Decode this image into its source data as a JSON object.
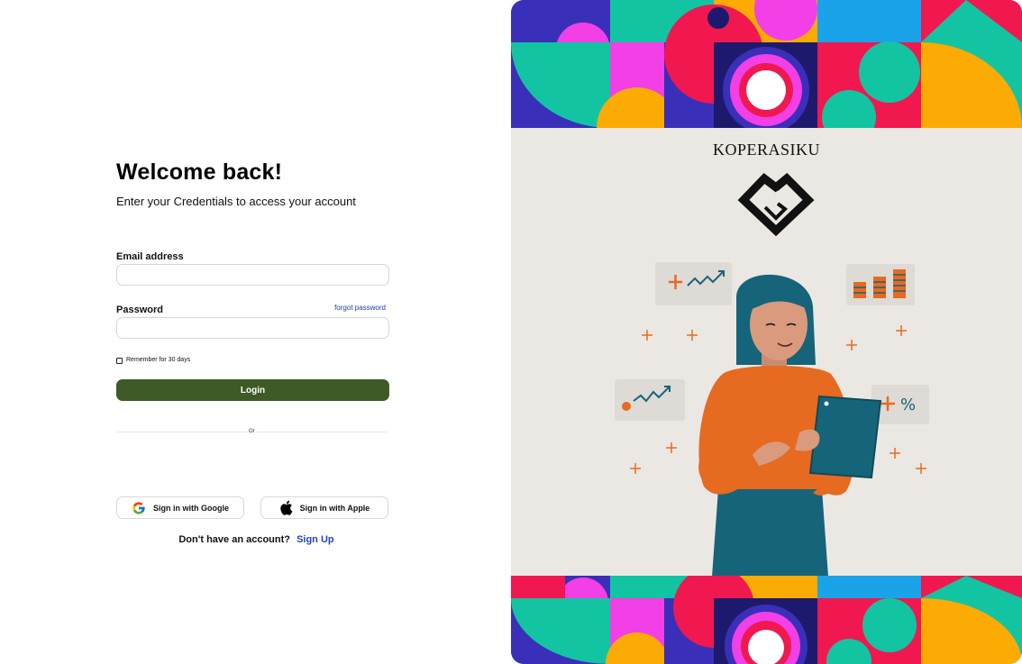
{
  "form": {
    "title": "Welcome back!",
    "subtitle": "Enter your Credentials to access your account",
    "email_label": "Email address",
    "email_value": "",
    "password_label": "Password",
    "password_value": "",
    "forgot_password": "forgot password",
    "remember_label": "Remember for 30 days",
    "login_button": "Login",
    "divider_text": "Or",
    "google_button": "Sign in with Google",
    "apple_button": "Sign in with Apple",
    "signup_prompt": "Don't have an account?",
    "signup_link": "Sign Up"
  },
  "brand": {
    "name": "KOPERASIKU"
  },
  "colors": {
    "login_button": "#3e5a26",
    "link_blue": "#1f45d1",
    "panel_bg": "#ebe8e4",
    "pattern_teal": "#13c4a3",
    "pattern_magenta": "#f23fe6",
    "pattern_red": "#f0184f",
    "pattern_blue": "#3a2fb8",
    "pattern_orange": "#fbab03",
    "pattern_navy": "#1d1a6e",
    "illustration_orange": "#e66a20",
    "illustration_teal": "#16647a"
  },
  "icons": {
    "google": "google-icon",
    "apple": "apple-icon",
    "logo": "handshake-diamond-logo"
  }
}
